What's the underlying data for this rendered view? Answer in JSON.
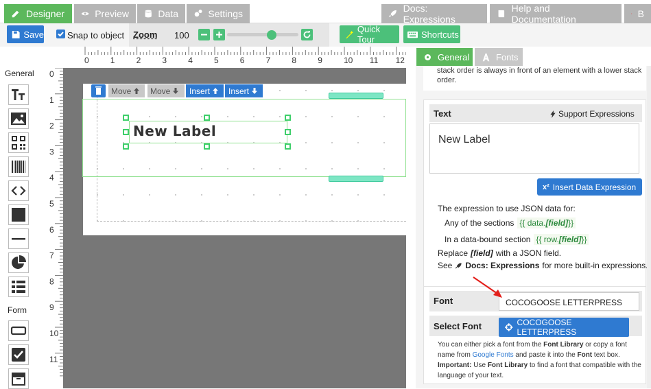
{
  "tabs": {
    "designer": "Designer",
    "preview": "Preview",
    "data": "Data",
    "settings": "Settings",
    "docs": "Docs: Expressions",
    "help": "Help and Documentation",
    "back": "B"
  },
  "toolbar": {
    "save": "Save",
    "snap_label": "Snap to object",
    "zoom_label": "Zoom",
    "zoom_value": "100",
    "quick_tour": "Quick Tour",
    "shortcuts": "Shortcuts"
  },
  "left": {
    "general_title": "General",
    "form_title": "Form"
  },
  "ruler": {
    "h": [
      "0",
      "1",
      "2",
      "3",
      "4",
      "5",
      "6",
      "7",
      "8",
      "9",
      "10",
      "11",
      "12"
    ],
    "v": [
      "0",
      "1",
      "2",
      "3",
      "4",
      "5",
      "6",
      "7",
      "8",
      "9",
      "10",
      "11"
    ]
  },
  "element_toolbar": {
    "move_up": "Move",
    "move_down": "Move",
    "insert_up": "Insert",
    "insert_down": "Insert"
  },
  "canvas": {
    "label_text": "New Label"
  },
  "right": {
    "tab_general": "General",
    "tab_fonts": "Fonts",
    "intro_line1": "stack order is always in front of an element with a lower stack",
    "intro_line2": "order.",
    "text_title": "Text",
    "support_expr": "Support Expressions",
    "text_value": "New Label",
    "insert_expr": "Insert Data Expression",
    "help_line1": "The expression to use JSON data for:",
    "help_any": "Any of the sections",
    "help_any_code_prefix": "{{ data.",
    "help_any_code_field": "[field]",
    "help_any_code_suffix": "}}",
    "help_bound": "In a data-bound section",
    "help_bound_code_prefix": "{{ row.",
    "help_bound_code_field": "[field]",
    "help_bound_code_suffix": "}}",
    "help_replace_pre": "Replace",
    "help_replace_field": "[field]",
    "help_replace_post": "with a JSON field.",
    "help_see_pre": "See",
    "help_see_link": "Docs: Expressions",
    "help_see_post": "for more built-in expressions.",
    "font_title": "Font",
    "font_value": "COCOGOOSE LETTERPRESS",
    "select_font_title": "Select Font",
    "select_font_btn": "COCOGOOSE LETTERPRESS",
    "font_help_1a": "You can either pick a font from the",
    "font_help_1b": "Font Library",
    "font_help_1c": "or copy a font",
    "font_help_2a": "name from",
    "font_help_2b": "Google Fonts",
    "font_help_2c": "and paste it into the",
    "font_help_2d": "Font",
    "font_help_2e": "text box.",
    "font_help_3a": "Important:",
    "font_help_3b": "Use",
    "font_help_3c": "Font Library",
    "font_help_3d": "to find a font that compatible with the",
    "font_help_4": "language of your text."
  }
}
